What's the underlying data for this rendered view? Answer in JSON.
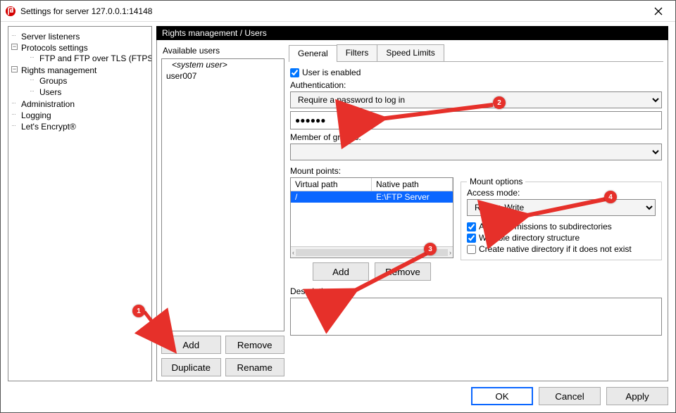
{
  "window": {
    "title": "Settings for server 127.0.0.1:14148"
  },
  "tree": {
    "server_listeners": "Server listeners",
    "protocols_settings": "Protocols settings",
    "ftp_ftps": "FTP and FTP over TLS (FTPS)",
    "rights_mgmt": "Rights management",
    "groups": "Groups",
    "users": "Users",
    "administration": "Administration",
    "logging": "Logging",
    "letsencrypt": "Let's Encrypt®"
  },
  "breadcrumb": "Rights management / Users",
  "users_panel": {
    "label": "Available users",
    "system_user": "<system user>",
    "items": [
      "user007"
    ],
    "btn_add": "Add",
    "btn_remove": "Remove",
    "btn_duplicate": "Duplicate",
    "btn_rename": "Rename"
  },
  "tabs": {
    "general": "General",
    "filters": "Filters",
    "speed": "Speed Limits"
  },
  "general": {
    "user_enabled": "User is enabled",
    "auth_label": "Authentication:",
    "auth_mode": "Require a password to log in",
    "password_masked": "●●●●●●",
    "member_label": "Member of groups:",
    "member_value": "",
    "mount_label": "Mount points:",
    "col_virtual": "Virtual path",
    "col_native": "Native path",
    "row_virtual": "/",
    "row_native": "E:\\FTP Server",
    "btn_mount_add": "Add",
    "btn_mount_remove": "Remove",
    "mount_options_title": "Mount options",
    "access_mode_label": "Access mode:",
    "access_mode_value": "Read + Write",
    "opt_apply_sub": "Apply permissions to subdirectories",
    "opt_writable": "Writable directory structure",
    "opt_create_native": "Create native directory if it does not exist",
    "desc_label": "Description:",
    "desc_value": ""
  },
  "footer": {
    "ok": "OK",
    "cancel": "Cancel",
    "apply": "Apply"
  },
  "annotations": {
    "n1": "1",
    "n2": "2",
    "n3": "3",
    "n4": "4"
  }
}
